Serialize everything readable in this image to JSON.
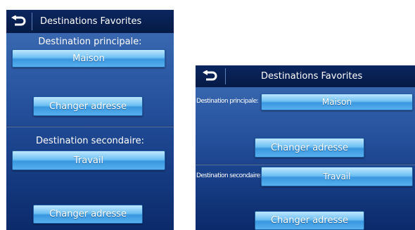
{
  "left_screen": {
    "title": "Destinations Favorites",
    "primary_label": "Destination principale:",
    "primary_value": "Maison",
    "change_label_1": "Changer adresse",
    "secondary_label": "Destination secondaire:",
    "secondary_value": "Travail",
    "change_label_2": "Changer adresse"
  },
  "right_screen": {
    "title": "Destinations Favorites",
    "primary_label": "Destination principale:",
    "primary_value": "Maison",
    "change_label_1": "Changer adresse",
    "secondary_label": "Destination secondaire:",
    "secondary_value": "Travail",
    "change_label_2": "Changer adresse"
  },
  "icons": {
    "back": "back-arrow-icon"
  },
  "colors": {
    "screen_top": "#3f6fb5",
    "screen_bottom": "#0b2a6a",
    "button": "#6ec0f3",
    "titlebar": "#0b2660"
  }
}
